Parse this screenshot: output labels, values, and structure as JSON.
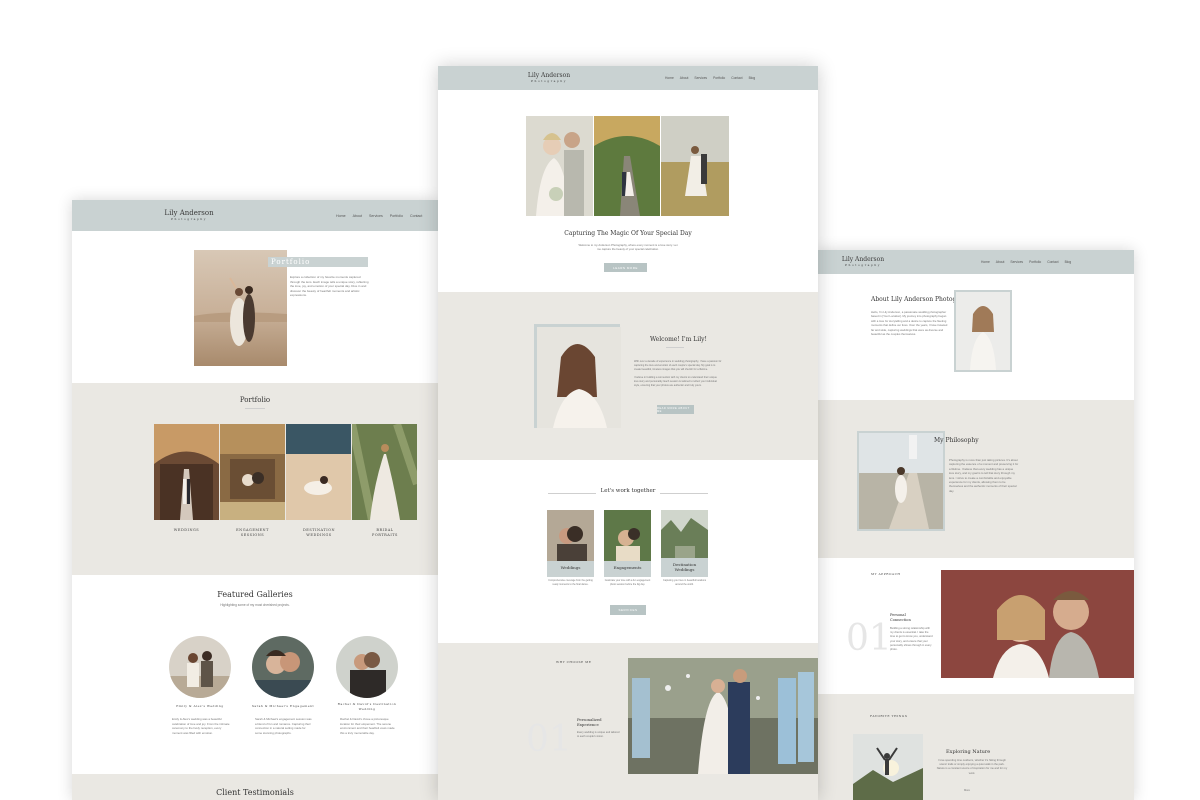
{
  "brand": {
    "name": "Lily Anderson",
    "tagline": "Photography"
  },
  "colors": {
    "nav": "#c9d2d2",
    "section_gray": "#eae8e3",
    "button": "#b8c4c4"
  },
  "left_page": {
    "menu": [
      "Home",
      "About",
      "Services",
      "Portfolio",
      "Contact"
    ],
    "hero": {
      "overlay_title": "Portfolio",
      "text": "Explore a collection of my favorite moments captured through the lens. Each image tells a unique story, reflecting the love, joy, and emotion of your special day. Dive in and discover the beauty of heartfelt moments and artistic expressions."
    },
    "portfolio": {
      "title": "Portfolio",
      "items": [
        "WEDDINGS",
        "ENGAGEMENT SESSIONS",
        "DESTINATION WEDDINGS",
        "BRIDAL PORTRAITS"
      ]
    },
    "featured": {
      "title": "Featured Galleries",
      "subtitle": "Highlighting some of my most cherished projects.",
      "items": [
        {
          "name": "Emily & Alex's Wedding",
          "text": "Emily & Alex's wedding was a beautiful celebration of love and joy. From the intimate ceremony to the lively reception, every moment was filled with emotion."
        },
        {
          "name": "Sarah & Michael's Engagement",
          "text": "Sarah & Michael's engagement session was a blend of fun and romance. Capturing their connection in a natural setting made for some stunning photographs."
        },
        {
          "name": "Rachel & David's Destination Wedding",
          "text": "Rachel & David's chose a picturesque location for their elopement. The serene environment and their heartfelt vows made this a truly memorable day."
        }
      ]
    },
    "testimonials_title": "Client Testimonials"
  },
  "center_page": {
    "menu": [
      "Home",
      "About",
      "Services",
      "Portfolio",
      "Contact",
      "Blog"
    ],
    "hero": {
      "title": "Capturing The Magic Of Your Special Day",
      "text": "Welcome to my Anderson Photography, where every moment is a love story. Let me capture the beauty of your special celebration.",
      "button": "LEARN MORE"
    },
    "welcome": {
      "title": "Welcome! I'm Lily!",
      "text1": "With over a decade of experience in wedding photography, I have a passion for capturing the love and emotion of each couple's special day. My goal is to create beautiful, timeless images that you will cherish for a lifetime.",
      "text2": "I believe in building a connection with my clients to understand their unique love story and personality. Each session is tailored to reflect your individual style, ensuring that your photos are authentic and truly yours.",
      "button": "READ MORE ABOUT ME"
    },
    "work": {
      "title": "Let's work together",
      "cards": [
        {
          "title": "Weddings",
          "text": "Comprehensive coverage from the getting ready moments to the final dance."
        },
        {
          "title": "Engagements",
          "text": "Celebrate your love with a fun engagement photo session before the big day."
        },
        {
          "title": "Destination Weddings",
          "text": "Capturing your love in beautiful locations around the world."
        }
      ],
      "button": "SERVICES"
    },
    "why": {
      "label": "WHY CHOOSE ME",
      "number": "01",
      "title": "Personalized Experience",
      "text": "Every wedding is unique and tailored to each couple's vision."
    }
  },
  "right_page": {
    "menu": [
      "Home",
      "About",
      "Services",
      "Portfolio",
      "Contact",
      "Blog"
    ],
    "about": {
      "title": "About Lily Anderson Photography",
      "text": "Hello, I'm Lily Anderson, a passionate wedding photographer based in [Your Location]. My journey into photography began with a love for storytelling and a desire to capture the fleeting moments that define our lives. Over the years, I have traveled far and wide, capturing weddings that were as diverse and beautiful as the couples themselves."
    },
    "philosophy": {
      "title": "My Philosophy",
      "text": "Photography is more than just taking pictures. It's about capturing the essence of a moment and preserving it for a lifetime. I believe that every wedding has a unique love story, and my goal is to tell that story through my lens. I strive to create a comfortable and enjoyable experience for my clients, allowing them to be themselves and the authentic moments of their special day."
    },
    "approach": {
      "label": "MY APPROACH",
      "number": "01",
      "title": "Personal Connection",
      "text": "Building a strong relationship with my clients is essential. I take the time to get to know you, understand your story, and ensure that your personality shines through in every photo."
    },
    "favorites": {
      "label": "FAVORITE THINGS",
      "title": "Exploring Nature",
      "text": "I love spending time outdoors, whether it's hiking through scenic trails or simply enjoying a quiet walk in the park. Nature is a constant source of inspiration for me and for my work.",
      "more": "More"
    }
  }
}
